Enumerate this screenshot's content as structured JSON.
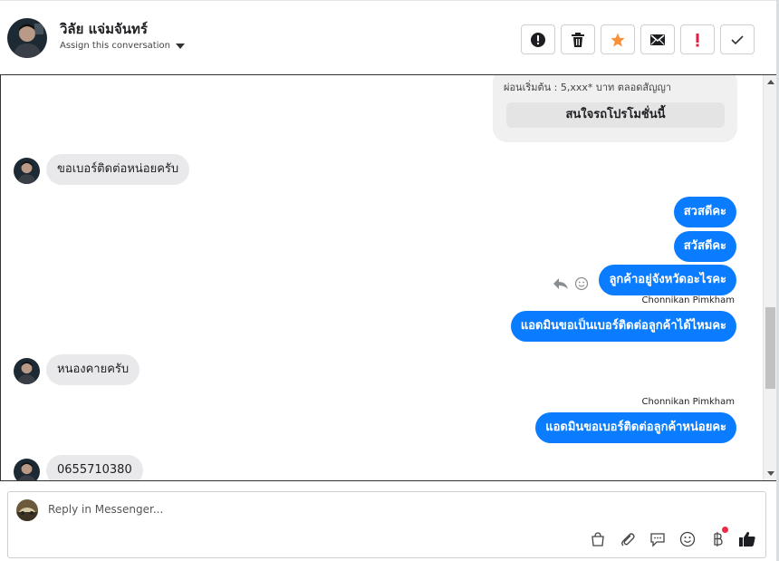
{
  "header": {
    "contact_name": "วิลัย แจ่มจันทร์",
    "assign_label": "Assign this conversation",
    "actions": [
      {
        "name": "spam-button",
        "icon": "alert-circle-icon"
      },
      {
        "name": "delete-button",
        "icon": "trash-icon"
      },
      {
        "name": "star-button",
        "icon": "star-icon"
      },
      {
        "name": "mark-unread-button",
        "icon": "envelope-icon"
      },
      {
        "name": "follow-up-button",
        "icon": "exclamation-icon"
      },
      {
        "name": "done-button",
        "icon": "checkmark-icon"
      }
    ]
  },
  "conversation": {
    "card": {
      "text": "ผ่อนเริ่มต้น : 5,xxx* บาท ตลอดสัญญา",
      "button": "สนใจรถโปรโมชั่นนี้"
    },
    "messages": [
      {
        "from": "customer",
        "text": "ขอเบอร์ติดต่อหน่อยครับ"
      },
      {
        "from": "page",
        "text": "สวสดีคะ"
      },
      {
        "from": "page",
        "text": "สวัสดีคะ"
      },
      {
        "from": "page",
        "text": "ลูกค้าอยู่จังหวัดอะไรคะ"
      },
      {
        "from": "page",
        "sender": "Chonnikan Pimkham",
        "text": "แอดมินขอเป็นเบอร์ติดต่อลูกค้าได้ไหมคะ"
      },
      {
        "from": "customer",
        "text": "หนองคายครับ"
      },
      {
        "from": "page",
        "sender": "Chonnikan Pimkham",
        "text": "แอดมินขอเบอร์ติดต่อลูกค้าหน่อยคะ"
      },
      {
        "from": "customer",
        "text": "0655710380"
      }
    ]
  },
  "reply": {
    "placeholder": "Reply in Messenger...",
    "tools": [
      "shopping-bag-icon",
      "paperclip-icon",
      "saved-replies-icon",
      "emoji-icon",
      "baht-payment-icon",
      "thumbs-up-icon"
    ]
  },
  "colors": {
    "accent": "#0a7cff",
    "incoming_bubble": "#e9e9eb",
    "star": "#f7923b",
    "alert": "#e41e3f"
  }
}
